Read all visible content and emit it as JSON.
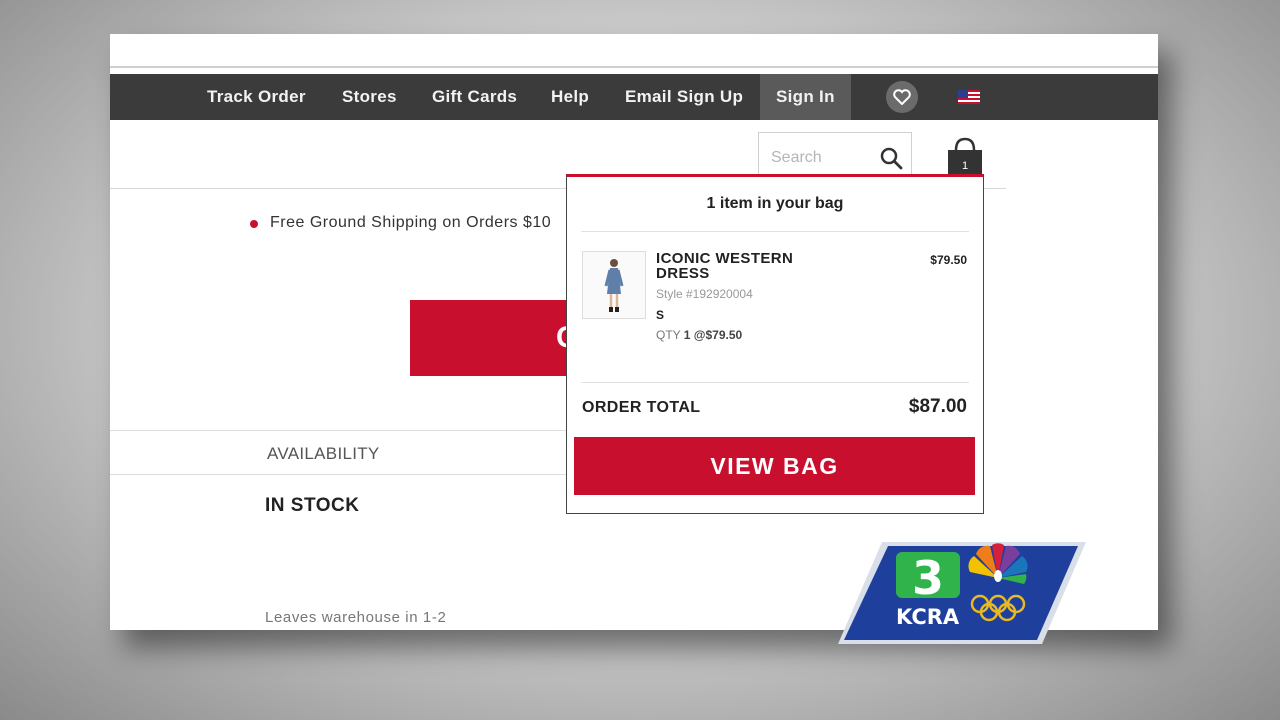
{
  "nav": {
    "items": [
      "Track Order",
      "Stores",
      "Gift Cards",
      "Help",
      "Email Sign Up"
    ],
    "sign_in": "Sign In",
    "wishlist_icon": "heart-icon",
    "flag_icon": "us-flag-icon"
  },
  "header": {
    "search_placeholder": "Search",
    "search_icon": "search-icon",
    "bag_icon": "shopping-bag-icon",
    "bag_count": "1"
  },
  "page": {
    "promo": "Free Ground Shipping on Orders $10",
    "cta_partial": "C",
    "availability_label": "AVAILABILITY",
    "availability_value": "IN STOCK",
    "leaves_text": "Leaves warehouse in 1-2"
  },
  "bag_popup": {
    "title": "1 item in your bag",
    "item": {
      "name": "ICONIC WESTERN DRESS",
      "price": "$79.50",
      "style": "Style #192920004",
      "size": "S",
      "qty_label": "QTY",
      "qty_value": "1 @$79.50"
    },
    "total_label": "ORDER TOTAL",
    "total_value": "$87.00",
    "view_bag": "VIEW BAG"
  },
  "station": {
    "number": "3",
    "call_letters": "KCRA"
  },
  "colors": {
    "brand_red": "#c8102e",
    "nav_bg": "#3b3b3b",
    "bug_blue": "#1f3f9c",
    "bug_green": "#2fb34a"
  }
}
